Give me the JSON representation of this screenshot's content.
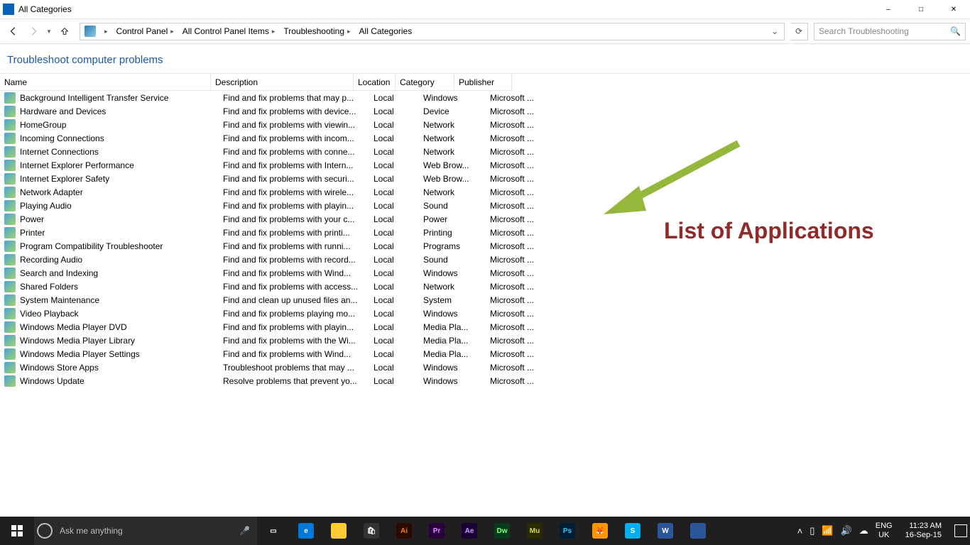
{
  "window": {
    "title": "All Categories"
  },
  "nav": {
    "breadcrumbs": [
      "Control Panel",
      "All Control Panel Items",
      "Troubleshooting",
      "All Categories"
    ],
    "search_placeholder": "Search Troubleshooting"
  },
  "page": {
    "heading": "Troubleshoot computer problems"
  },
  "columns": {
    "name": "Name",
    "desc": "Description",
    "loc": "Location",
    "cat": "Category",
    "pub": "Publisher"
  },
  "rows": [
    {
      "name": "Background Intelligent Transfer Service",
      "desc": "Find and fix problems that may p...",
      "loc": "Local",
      "cat": "Windows",
      "pub": "Microsoft ..."
    },
    {
      "name": "Hardware and Devices",
      "desc": "Find and fix problems with device...",
      "loc": "Local",
      "cat": "Device",
      "pub": "Microsoft ..."
    },
    {
      "name": "HomeGroup",
      "desc": "Find and fix problems with viewin...",
      "loc": "Local",
      "cat": "Network",
      "pub": "Microsoft ..."
    },
    {
      "name": "Incoming Connections",
      "desc": "Find and fix problems with incom...",
      "loc": "Local",
      "cat": "Network",
      "pub": "Microsoft ..."
    },
    {
      "name": "Internet Connections",
      "desc": "Find and fix problems with conne...",
      "loc": "Local",
      "cat": "Network",
      "pub": "Microsoft ..."
    },
    {
      "name": "Internet Explorer Performance",
      "desc": "Find and fix problems with Intern...",
      "loc": "Local",
      "cat": "Web Brow...",
      "pub": "Microsoft ..."
    },
    {
      "name": "Internet Explorer Safety",
      "desc": "Find and fix problems with securi...",
      "loc": "Local",
      "cat": "Web Brow...",
      "pub": "Microsoft ..."
    },
    {
      "name": "Network Adapter",
      "desc": "Find and fix problems with wirele...",
      "loc": "Local",
      "cat": "Network",
      "pub": "Microsoft ..."
    },
    {
      "name": "Playing Audio",
      "desc": "Find and fix problems with playin...",
      "loc": "Local",
      "cat": "Sound",
      "pub": "Microsoft ..."
    },
    {
      "name": "Power",
      "desc": "Find and fix problems with your c...",
      "loc": "Local",
      "cat": "Power",
      "pub": "Microsoft ..."
    },
    {
      "name": "Printer",
      "desc": "Find and fix problems with printi...",
      "loc": "Local",
      "cat": "Printing",
      "pub": "Microsoft ..."
    },
    {
      "name": "Program Compatibility Troubleshooter",
      "desc": "Find and fix problems with runni...",
      "loc": "Local",
      "cat": "Programs",
      "pub": "Microsoft ..."
    },
    {
      "name": "Recording Audio",
      "desc": "Find and fix problems with record...",
      "loc": "Local",
      "cat": "Sound",
      "pub": "Microsoft ..."
    },
    {
      "name": "Search and Indexing",
      "desc": "Find and fix problems with Wind...",
      "loc": "Local",
      "cat": "Windows",
      "pub": "Microsoft ..."
    },
    {
      "name": "Shared Folders",
      "desc": "Find and fix problems with access...",
      "loc": "Local",
      "cat": "Network",
      "pub": "Microsoft ..."
    },
    {
      "name": "System Maintenance",
      "desc": "Find and clean up unused files an...",
      "loc": "Local",
      "cat": "System",
      "pub": "Microsoft ..."
    },
    {
      "name": "Video Playback",
      "desc": "Find and fix problems playing mo...",
      "loc": "Local",
      "cat": "Windows",
      "pub": "Microsoft ..."
    },
    {
      "name": "Windows Media Player DVD",
      "desc": "Find and fix problems with playin...",
      "loc": "Local",
      "cat": "Media Pla...",
      "pub": "Microsoft ..."
    },
    {
      "name": "Windows Media Player Library",
      "desc": "Find and fix problems with the Wi...",
      "loc": "Local",
      "cat": "Media Pla...",
      "pub": "Microsoft ..."
    },
    {
      "name": "Windows Media Player Settings",
      "desc": "Find and fix problems with Wind...",
      "loc": "Local",
      "cat": "Media Pla...",
      "pub": "Microsoft ..."
    },
    {
      "name": "Windows Store Apps",
      "desc": "Troubleshoot problems that may ...",
      "loc": "Local",
      "cat": "Windows",
      "pub": "Microsoft ..."
    },
    {
      "name": "Windows Update",
      "desc": "Resolve problems that prevent yo...",
      "loc": "Local",
      "cat": "Windows",
      "pub": "Microsoft ..."
    }
  ],
  "annotation": {
    "text": "List of Applications",
    "color": "#932a2a",
    "arrow_color": "#95b73b"
  },
  "taskbar": {
    "cortana_placeholder": "Ask me anything",
    "apps": [
      {
        "name": "task-view",
        "bg": "transparent",
        "label": "▭"
      },
      {
        "name": "edge",
        "bg": "#0078d7",
        "label": "e"
      },
      {
        "name": "file-explorer",
        "bg": "#ffcc33",
        "label": ""
      },
      {
        "name": "store",
        "bg": "#333",
        "label": "🛍"
      },
      {
        "name": "illustrator",
        "bg": "#2a0a00",
        "label": "Ai",
        "fg": "#ff7c00"
      },
      {
        "name": "premiere",
        "bg": "#2a003f",
        "label": "Pr",
        "fg": "#e389ff"
      },
      {
        "name": "aftereffects",
        "bg": "#1a0033",
        "label": "Ae",
        "fg": "#c99cff"
      },
      {
        "name": "dreamweaver",
        "bg": "#083b1a",
        "label": "Dw",
        "fg": "#7fff7f"
      },
      {
        "name": "muse",
        "bg": "#2a2a00",
        "label": "Mu",
        "fg": "#d4d462"
      },
      {
        "name": "photoshop",
        "bg": "#001e36",
        "label": "Ps",
        "fg": "#31c5f0"
      },
      {
        "name": "firefox",
        "bg": "#ff9500",
        "label": "🦊"
      },
      {
        "name": "skype",
        "bg": "#00aff0",
        "label": "S"
      },
      {
        "name": "word",
        "bg": "#2b579a",
        "label": "W"
      },
      {
        "name": "app",
        "bg": "#2b579a",
        "label": ""
      }
    ],
    "lang1": "ENG",
    "lang2": "UK",
    "time": "11:23 AM",
    "date": "16-Sep-15"
  }
}
